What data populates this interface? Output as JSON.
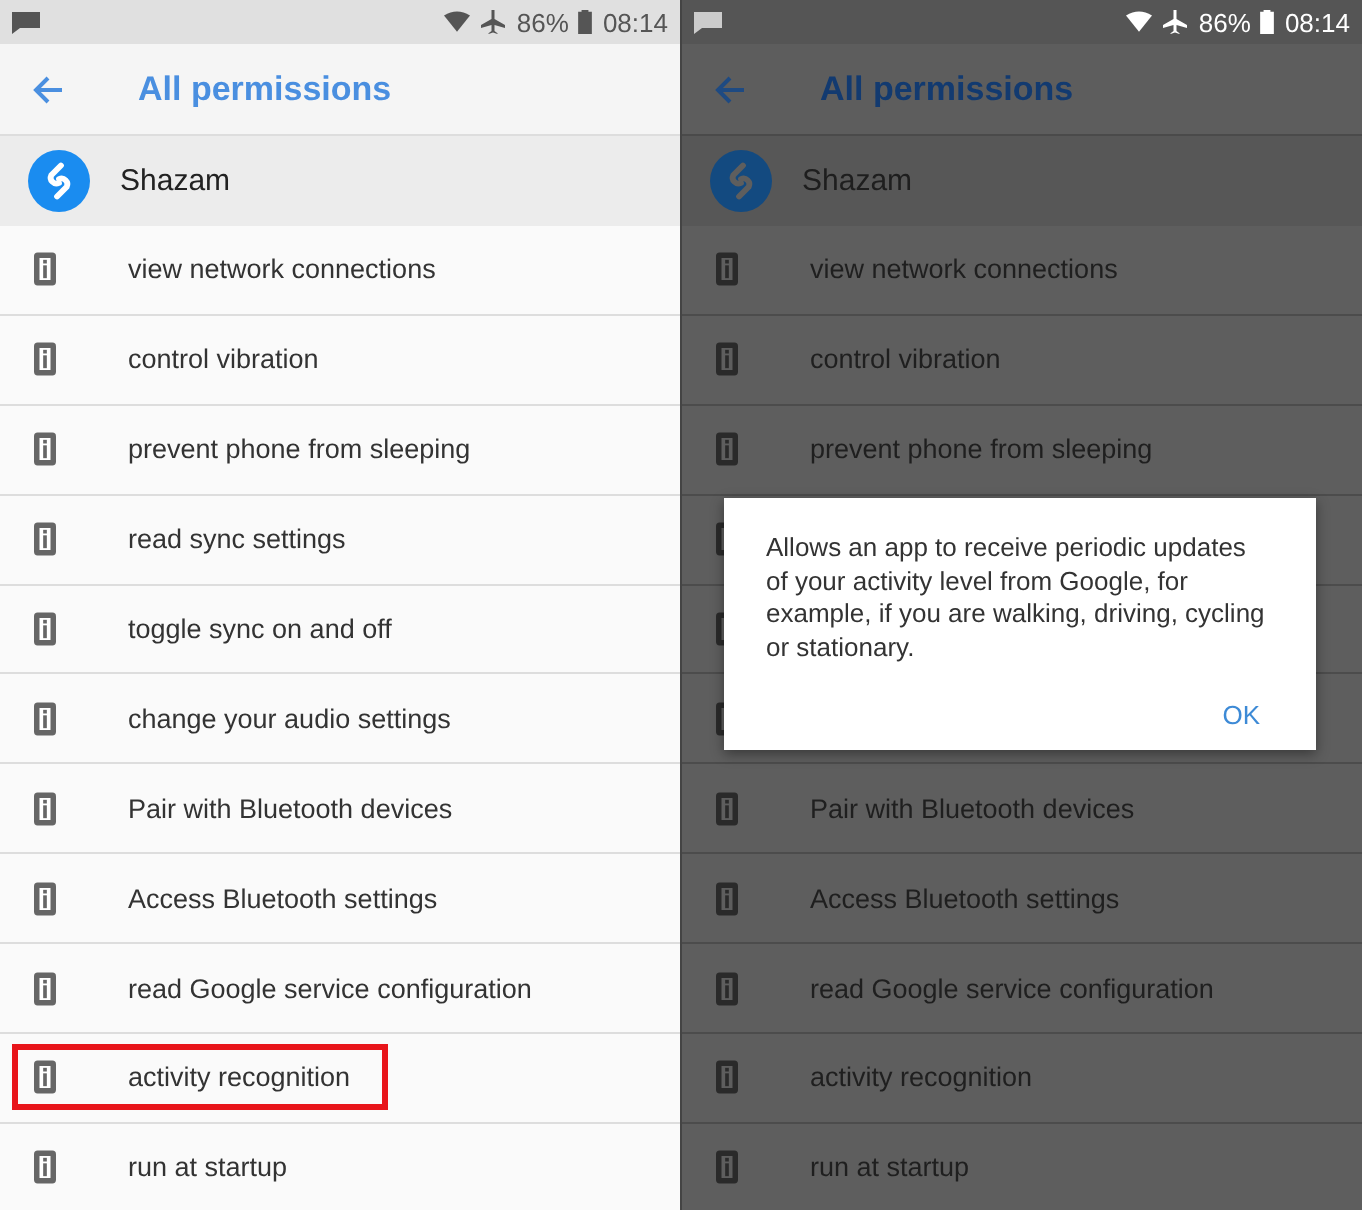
{
  "screens": [
    {
      "dimmed": false,
      "status_bar": {
        "battery": "86%",
        "time": "08:14"
      },
      "toolbar": {
        "title": "All permissions"
      },
      "app": {
        "name": "Shazam"
      },
      "permissions": [
        {
          "kind": "row",
          "label": "view network connections",
          "highlighted": false
        },
        {
          "kind": "row",
          "label": "control vibration",
          "highlighted": false
        },
        {
          "kind": "row",
          "label": "prevent phone from sleeping",
          "highlighted": false
        },
        {
          "kind": "row",
          "label": "read sync settings",
          "highlighted": false
        },
        {
          "kind": "row",
          "label": "toggle sync on and off",
          "highlighted": false
        },
        {
          "kind": "row",
          "label": "change your audio settings",
          "highlighted": false
        },
        {
          "kind": "row",
          "label": "Pair with Bluetooth devices",
          "highlighted": false
        },
        {
          "kind": "row",
          "label": "Access Bluetooth settings",
          "highlighted": false
        },
        {
          "kind": "row",
          "label": "read Google service configuration",
          "highlighted": false
        },
        {
          "kind": "row",
          "label": "activity recognition",
          "highlighted": true
        },
        {
          "kind": "row",
          "label": "run at startup",
          "highlighted": false
        }
      ]
    },
    {
      "dimmed": true,
      "status_bar": {
        "battery": "86%",
        "time": "08:14"
      },
      "toolbar": {
        "title": "All permissions"
      },
      "app": {
        "name": "Shazam"
      },
      "permissions": [
        {
          "kind": "row",
          "label": "view network connections",
          "highlighted": false
        },
        {
          "kind": "row",
          "label": "control vibration",
          "highlighted": false
        },
        {
          "kind": "row",
          "label": "prevent phone from sleeping",
          "highlighted": false
        },
        {
          "kind": "covered"
        },
        {
          "kind": "covered"
        },
        {
          "kind": "covered"
        },
        {
          "kind": "row",
          "label": "Pair with Bluetooth devices",
          "highlighted": false
        },
        {
          "kind": "row",
          "label": "Access Bluetooth settings",
          "highlighted": false
        },
        {
          "kind": "row",
          "label": "read Google service configuration",
          "highlighted": false
        },
        {
          "kind": "row",
          "label": "activity recognition",
          "highlighted": false
        },
        {
          "kind": "row",
          "label": "run at startup",
          "highlighted": false
        }
      ],
      "dialog": {
        "message": "Allows an app to receive periodic updates of your activity level from Google, for example, if you are walking, driving, cycling or stationary.",
        "button": "OK"
      }
    }
  ]
}
